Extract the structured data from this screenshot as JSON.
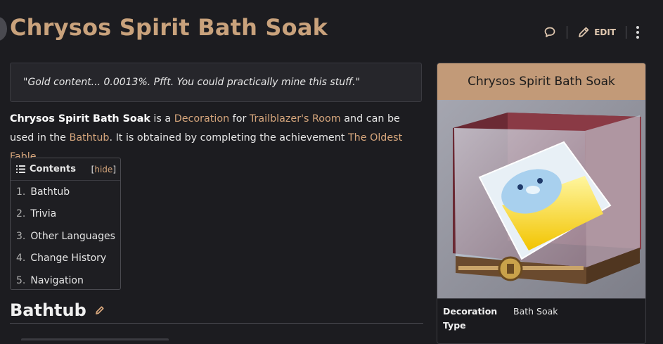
{
  "page": {
    "title": "Chrysos Spirit Bath Soak"
  },
  "toolbar": {
    "comment_icon": "speech-bubble-icon",
    "edit_label": "EDIT",
    "edit_icon": "pencil-icon",
    "more_icon": "vertical-dots-icon"
  },
  "quote": "\"Gold content... 0.0013%. Pfft. You could practically mine this stuff.\"",
  "intro": {
    "name": "Chrysos Spirit Bath Soak",
    "t1": " is a ",
    "link_decoration": "Decoration",
    "t2": " for ",
    "link_room": "Trailblazer's Room",
    "t3": " and can be used in the ",
    "link_bathtub": "Bathtub",
    "t4": ". It is obtained by completing the achievement ",
    "link_achievement": "The Oldest Fable",
    "t5": "."
  },
  "toc": {
    "title": "Contents",
    "bracket_open": "[",
    "hide_label": "hide",
    "bracket_close": "]",
    "items": [
      {
        "num": "1.",
        "label": "Bathtub"
      },
      {
        "num": "2.",
        "label": "Trivia"
      },
      {
        "num": "3.",
        "label": "Other Languages"
      },
      {
        "num": "4.",
        "label": "Change History"
      },
      {
        "num": "5.",
        "label": "Navigation"
      }
    ]
  },
  "section": {
    "title": "Bathtub",
    "edit_icon": "pencil-icon"
  },
  "infobox": {
    "title": "Chrysos Spirit Bath Soak",
    "rows": [
      {
        "key": "Decoration Type",
        "value": "Bath Soak"
      }
    ]
  },
  "colors": {
    "accent": "#c9a27c",
    "link": "#d6a67c",
    "infobox_header": "#c29a78",
    "background": "#1c1c20"
  }
}
